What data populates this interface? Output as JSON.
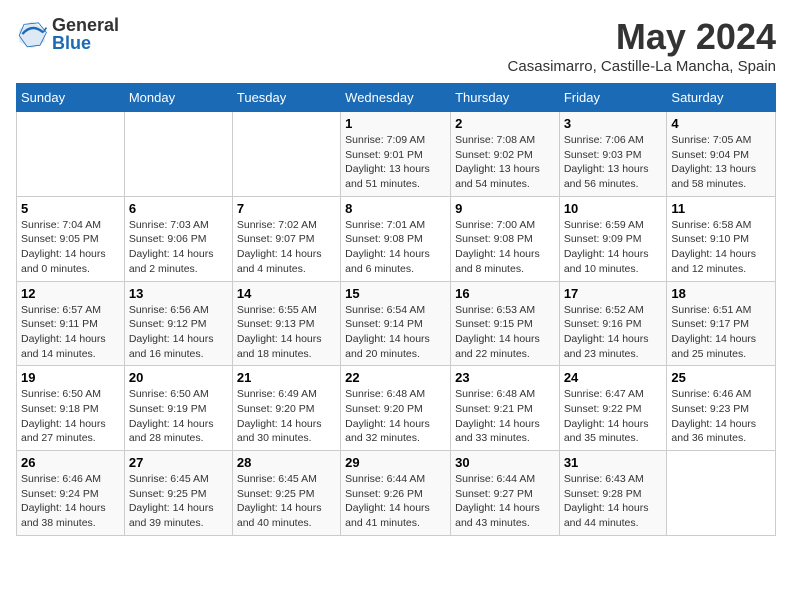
{
  "header": {
    "logo_line1": "General",
    "logo_line2": "Blue",
    "month": "May 2024",
    "location": "Casasimarro, Castille-La Mancha, Spain"
  },
  "days_of_week": [
    "Sunday",
    "Monday",
    "Tuesday",
    "Wednesday",
    "Thursday",
    "Friday",
    "Saturday"
  ],
  "weeks": [
    [
      {
        "day": "",
        "info": ""
      },
      {
        "day": "",
        "info": ""
      },
      {
        "day": "",
        "info": ""
      },
      {
        "day": "1",
        "info": "Sunrise: 7:09 AM\nSunset: 9:01 PM\nDaylight: 13 hours\nand 51 minutes."
      },
      {
        "day": "2",
        "info": "Sunrise: 7:08 AM\nSunset: 9:02 PM\nDaylight: 13 hours\nand 54 minutes."
      },
      {
        "day": "3",
        "info": "Sunrise: 7:06 AM\nSunset: 9:03 PM\nDaylight: 13 hours\nand 56 minutes."
      },
      {
        "day": "4",
        "info": "Sunrise: 7:05 AM\nSunset: 9:04 PM\nDaylight: 13 hours\nand 58 minutes."
      }
    ],
    [
      {
        "day": "5",
        "info": "Sunrise: 7:04 AM\nSunset: 9:05 PM\nDaylight: 14 hours\nand 0 minutes."
      },
      {
        "day": "6",
        "info": "Sunrise: 7:03 AM\nSunset: 9:06 PM\nDaylight: 14 hours\nand 2 minutes."
      },
      {
        "day": "7",
        "info": "Sunrise: 7:02 AM\nSunset: 9:07 PM\nDaylight: 14 hours\nand 4 minutes."
      },
      {
        "day": "8",
        "info": "Sunrise: 7:01 AM\nSunset: 9:08 PM\nDaylight: 14 hours\nand 6 minutes."
      },
      {
        "day": "9",
        "info": "Sunrise: 7:00 AM\nSunset: 9:08 PM\nDaylight: 14 hours\nand 8 minutes."
      },
      {
        "day": "10",
        "info": "Sunrise: 6:59 AM\nSunset: 9:09 PM\nDaylight: 14 hours\nand 10 minutes."
      },
      {
        "day": "11",
        "info": "Sunrise: 6:58 AM\nSunset: 9:10 PM\nDaylight: 14 hours\nand 12 minutes."
      }
    ],
    [
      {
        "day": "12",
        "info": "Sunrise: 6:57 AM\nSunset: 9:11 PM\nDaylight: 14 hours\nand 14 minutes."
      },
      {
        "day": "13",
        "info": "Sunrise: 6:56 AM\nSunset: 9:12 PM\nDaylight: 14 hours\nand 16 minutes."
      },
      {
        "day": "14",
        "info": "Sunrise: 6:55 AM\nSunset: 9:13 PM\nDaylight: 14 hours\nand 18 minutes."
      },
      {
        "day": "15",
        "info": "Sunrise: 6:54 AM\nSunset: 9:14 PM\nDaylight: 14 hours\nand 20 minutes."
      },
      {
        "day": "16",
        "info": "Sunrise: 6:53 AM\nSunset: 9:15 PM\nDaylight: 14 hours\nand 22 minutes."
      },
      {
        "day": "17",
        "info": "Sunrise: 6:52 AM\nSunset: 9:16 PM\nDaylight: 14 hours\nand 23 minutes."
      },
      {
        "day": "18",
        "info": "Sunrise: 6:51 AM\nSunset: 9:17 PM\nDaylight: 14 hours\nand 25 minutes."
      }
    ],
    [
      {
        "day": "19",
        "info": "Sunrise: 6:50 AM\nSunset: 9:18 PM\nDaylight: 14 hours\nand 27 minutes."
      },
      {
        "day": "20",
        "info": "Sunrise: 6:50 AM\nSunset: 9:19 PM\nDaylight: 14 hours\nand 28 minutes."
      },
      {
        "day": "21",
        "info": "Sunrise: 6:49 AM\nSunset: 9:20 PM\nDaylight: 14 hours\nand 30 minutes."
      },
      {
        "day": "22",
        "info": "Sunrise: 6:48 AM\nSunset: 9:20 PM\nDaylight: 14 hours\nand 32 minutes."
      },
      {
        "day": "23",
        "info": "Sunrise: 6:48 AM\nSunset: 9:21 PM\nDaylight: 14 hours\nand 33 minutes."
      },
      {
        "day": "24",
        "info": "Sunrise: 6:47 AM\nSunset: 9:22 PM\nDaylight: 14 hours\nand 35 minutes."
      },
      {
        "day": "25",
        "info": "Sunrise: 6:46 AM\nSunset: 9:23 PM\nDaylight: 14 hours\nand 36 minutes."
      }
    ],
    [
      {
        "day": "26",
        "info": "Sunrise: 6:46 AM\nSunset: 9:24 PM\nDaylight: 14 hours\nand 38 minutes."
      },
      {
        "day": "27",
        "info": "Sunrise: 6:45 AM\nSunset: 9:25 PM\nDaylight: 14 hours\nand 39 minutes."
      },
      {
        "day": "28",
        "info": "Sunrise: 6:45 AM\nSunset: 9:25 PM\nDaylight: 14 hours\nand 40 minutes."
      },
      {
        "day": "29",
        "info": "Sunrise: 6:44 AM\nSunset: 9:26 PM\nDaylight: 14 hours\nand 41 minutes."
      },
      {
        "day": "30",
        "info": "Sunrise: 6:44 AM\nSunset: 9:27 PM\nDaylight: 14 hours\nand 43 minutes."
      },
      {
        "day": "31",
        "info": "Sunrise: 6:43 AM\nSunset: 9:28 PM\nDaylight: 14 hours\nand 44 minutes."
      },
      {
        "day": "",
        "info": ""
      }
    ]
  ]
}
